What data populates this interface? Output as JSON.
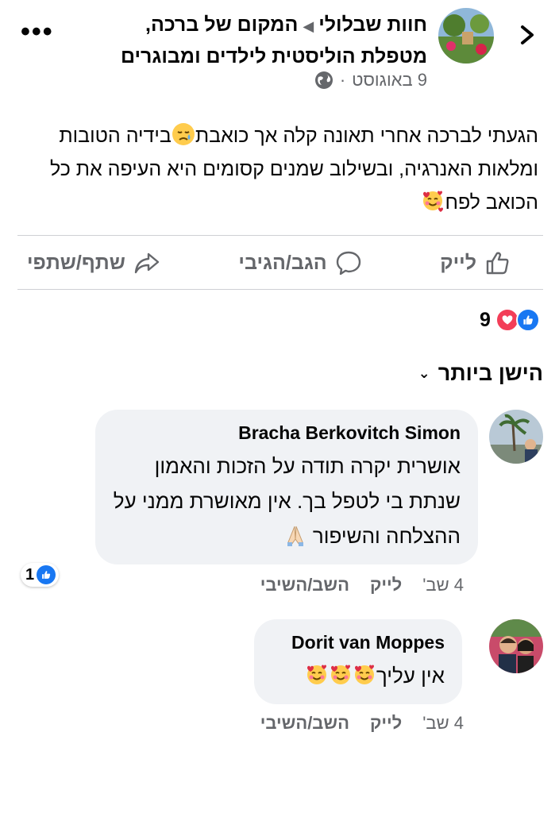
{
  "header": {
    "page_name": "חוות שבלולי",
    "arrow": "◀",
    "group_name": "המקום של ברכה, מטפלת הוליסטית לילדים ומבוגרים",
    "date": "9 באוגוסט",
    "separator": "·",
    "more": "•••"
  },
  "post": {
    "line1_before": "הגעתי לברכה אחרי תאונה קלה אך כואבת",
    "line1_after": "בידיה הטובות ומלאות האנרגיה, ובשילוב שמנים קסומים היא העיפה את כל הכואב לפח"
  },
  "actions": {
    "like": "לייק",
    "comment": "הגב/הגיבי",
    "share": "שתף/שתפי"
  },
  "reactions": {
    "count": "9"
  },
  "sort": {
    "label": "הישן ביותר"
  },
  "comments": [
    {
      "author": "Bracha Berkovitch Simon",
      "text": "אושרית יקרה תודה על הזכות והאמון שנתת בי לטפל בך. אין מאושרת ממני על ההצלחה והשיפור",
      "reaction_count": "1",
      "time": "4 שב'",
      "like": "לייק",
      "reply": "השב/השיבי"
    },
    {
      "author": "Dorit van Moppes",
      "text": "אין עליך",
      "time": "4 שב'",
      "like": "לייק",
      "reply": "השב/השיבי"
    }
  ],
  "colors": {
    "accent": "#1877f2",
    "love": "#f33e58",
    "secondary_text": "#65676b",
    "bubble": "#f0f2f5"
  }
}
